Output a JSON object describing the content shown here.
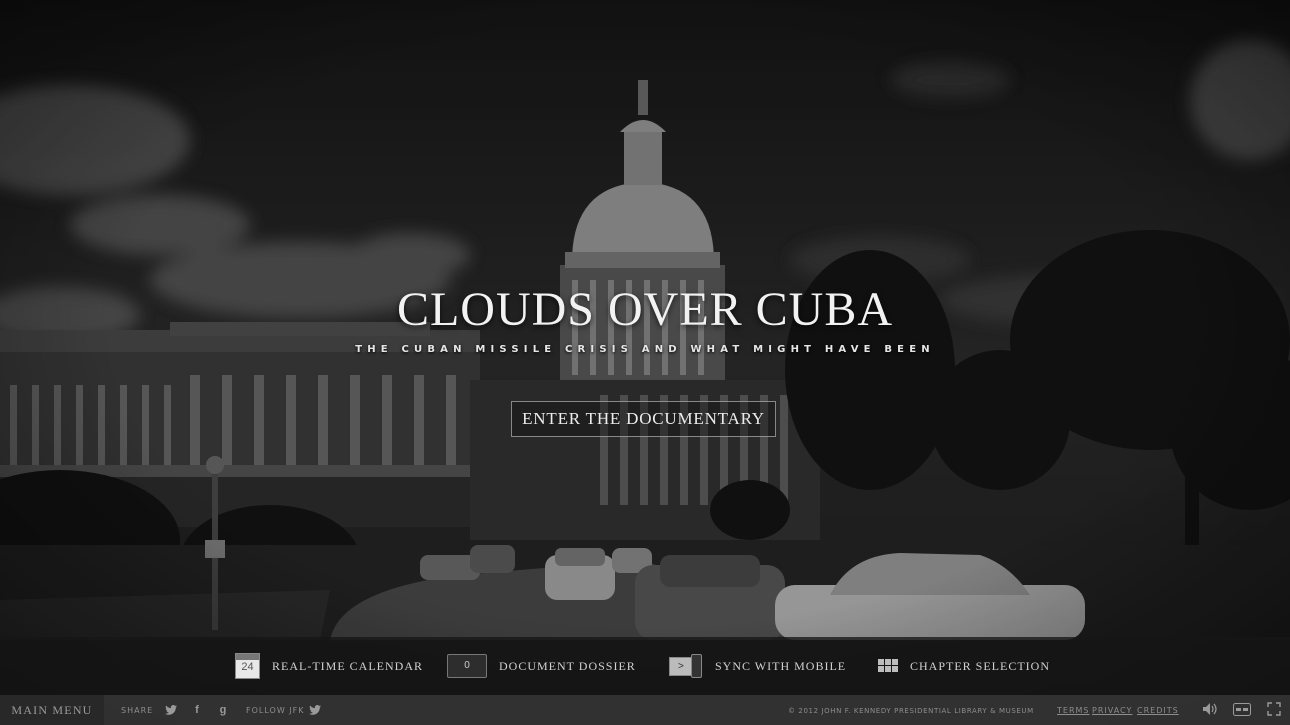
{
  "hero": {
    "title": "CLOUDS OVER CUBA",
    "subtitle": "THE CUBAN MISSILE CRISIS AND WHAT MIGHT HAVE BEEN",
    "cta_label": "ENTER THE DOCUMENTARY"
  },
  "features": [
    {
      "label": "REAL-TIME CALENDAR",
      "icon": "calendar-icon",
      "icon_text": "24"
    },
    {
      "label": "DOCUMENT DOSSIER",
      "icon": "folder-icon",
      "icon_text": "0"
    },
    {
      "label": "SYNC WITH MOBILE",
      "icon": "sync-mobile-icon",
      "icon_text": ">"
    },
    {
      "label": "CHAPTER SELECTION",
      "icon": "grid-icon"
    }
  ],
  "footer": {
    "main_menu": "MAIN MENU",
    "share_label": "SHARE",
    "share_icons": [
      "twitter-icon",
      "facebook-icon",
      "google-plus-icon"
    ],
    "follow_label": "FOLLOW JFK",
    "follow_icon": "twitter-icon",
    "copyright": "© 2012 JOHN F. KENNEDY PRESIDENTIAL LIBRARY & MUSEUM",
    "links": [
      "TERMS",
      "PRIVACY",
      "CREDITS"
    ],
    "controls": [
      "volume-icon",
      "captions-icon",
      "fullscreen-icon"
    ]
  },
  "colors": {
    "sky": "#2a2a2a",
    "text": "#f2f2f2",
    "bar": "#1c1c1c",
    "footer": "#3a3a3a"
  }
}
